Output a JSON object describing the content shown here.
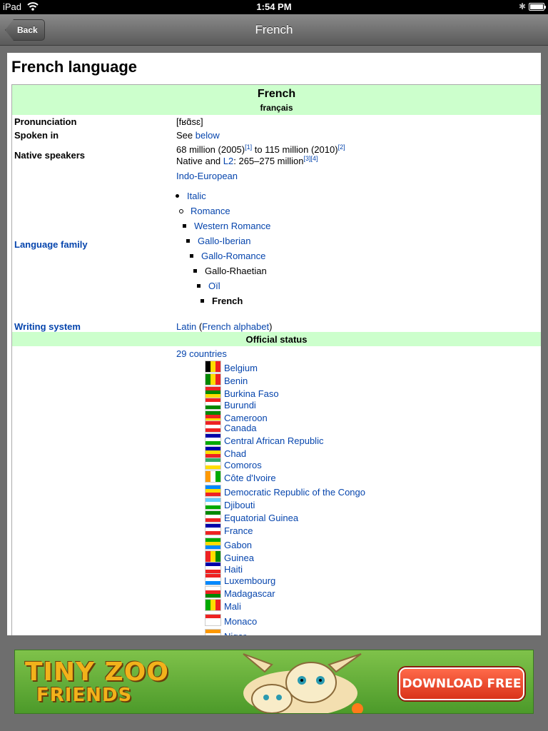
{
  "status_bar": {
    "device": "iPad",
    "time": "1:54 PM"
  },
  "nav": {
    "back_label": "Back",
    "title": "French"
  },
  "article": {
    "heading": "French language",
    "infobox": {
      "name": "French",
      "native_name": "français",
      "pronunciation_label": "Pronunciation",
      "pronunciation_value": "[fʁɑ̃sɛ]",
      "spoken_in_label": "Spoken in",
      "spoken_in_prefix": "See ",
      "spoken_in_link": "below",
      "native_speakers_label": "Native speakers",
      "ns_line1_a": "68 million (2005)",
      "ns_ref1": "[1]",
      "ns_line1_b": " to 115 million (2010)",
      "ns_ref2": "[2]",
      "ns_line2_a": "Native and ",
      "ns_line2_link": "L2",
      "ns_line2_b": ": 265–275 million",
      "ns_ref3": "[3]",
      "ns_ref4": "[4]",
      "language_family_label": "Language family",
      "family_root": "Indo-European",
      "family_tree": [
        {
          "label": "Italic",
          "is_link": true
        },
        {
          "label": "Romance",
          "is_link": true
        },
        {
          "label": "Western Romance",
          "is_link": true
        },
        {
          "label": "Gallo-Iberian",
          "is_link": true
        },
        {
          "label": "Gallo-Romance",
          "is_link": true
        },
        {
          "label": "Gallo-Rhaetian",
          "is_link": false
        },
        {
          "label": "Oïl",
          "is_link": true
        },
        {
          "label": "French",
          "is_link": false,
          "bold": true
        }
      ],
      "writing_system_label": "Writing system",
      "writing_system_link1": "Latin",
      "writing_system_link2": "French alphabet",
      "official_status_header": "Official status",
      "countries_link": "29 countries",
      "countries": [
        "Belgium",
        "Benin",
        "Burkina Faso",
        "Burundi",
        "Cameroon",
        "Canada",
        "Central African Republic",
        "Chad",
        "Comoros",
        "Côte d'Ivoire",
        "Democratic Republic of the Congo",
        "Djibouti",
        "Equatorial Guinea",
        "France",
        "Gabon",
        "Guinea",
        "Haiti",
        "Luxembourg",
        "Madagascar",
        "Mali",
        "Monaco",
        "Niger"
      ]
    }
  },
  "ad": {
    "brand_line1": "TINY ZOO",
    "brand_line2": "FRIENDS",
    "cta": "DOWNLOAD FREE"
  },
  "colors": {
    "link": "#0645ad",
    "infobox_header": "#ccffcc",
    "navbar": "#6e6e6e"
  }
}
